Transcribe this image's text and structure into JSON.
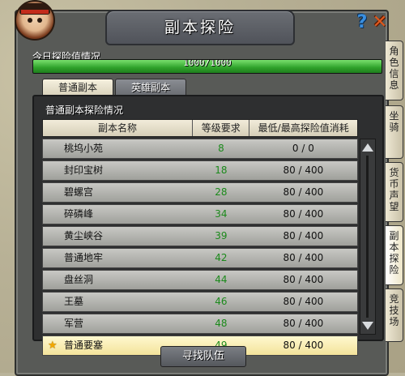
{
  "window": {
    "title": "副本探险"
  },
  "explore": {
    "label": "今日探险值情况",
    "value_text": "1000/1000",
    "progress": 1.0
  },
  "tabs": [
    {
      "label": "普通副本",
      "active": true
    },
    {
      "label": "英雄副本",
      "active": false
    }
  ],
  "section": {
    "title": "普通副本探险情况"
  },
  "table": {
    "headers": [
      "副本名称",
      "等级要求",
      "最低/最高探险值消耗"
    ],
    "rows": [
      {
        "name": "桃坞小苑",
        "level": "8",
        "cost": "0 / 0"
      },
      {
        "name": "封印宝树",
        "level": "18",
        "cost": "80 / 400"
      },
      {
        "name": "碧螺宫",
        "level": "28",
        "cost": "80 / 400"
      },
      {
        "name": "碎磷峰",
        "level": "34",
        "cost": "80 / 400"
      },
      {
        "name": "黄尘峡谷",
        "level": "39",
        "cost": "80 / 400"
      },
      {
        "name": "普通地牢",
        "level": "42",
        "cost": "80 / 400"
      },
      {
        "name": "盘丝洞",
        "level": "44",
        "cost": "80 / 400"
      },
      {
        "name": "王墓",
        "level": "46",
        "cost": "80 / 400"
      },
      {
        "name": "军营",
        "level": "48",
        "cost": "80 / 400"
      },
      {
        "name": "普通要塞",
        "level": "49",
        "cost": "80 / 400",
        "selected": true
      }
    ]
  },
  "buttons": {
    "find_team": "寻找队伍",
    "help": "?",
    "close": "✕"
  },
  "side_tabs": [
    {
      "label": "角色信息",
      "active": false
    },
    {
      "label": "坐骑",
      "active": false
    },
    {
      "label": "货币声望",
      "active": false
    },
    {
      "label": "副本探险",
      "active": true
    },
    {
      "label": "竞技场",
      "active": false
    }
  ],
  "icons": {
    "star": "★",
    "avatar": "character-portrait-icon"
  },
  "colors": {
    "level_text": "#1b8a1b",
    "progress": "#2ea12a",
    "selected_row": "#f3e39b"
  }
}
